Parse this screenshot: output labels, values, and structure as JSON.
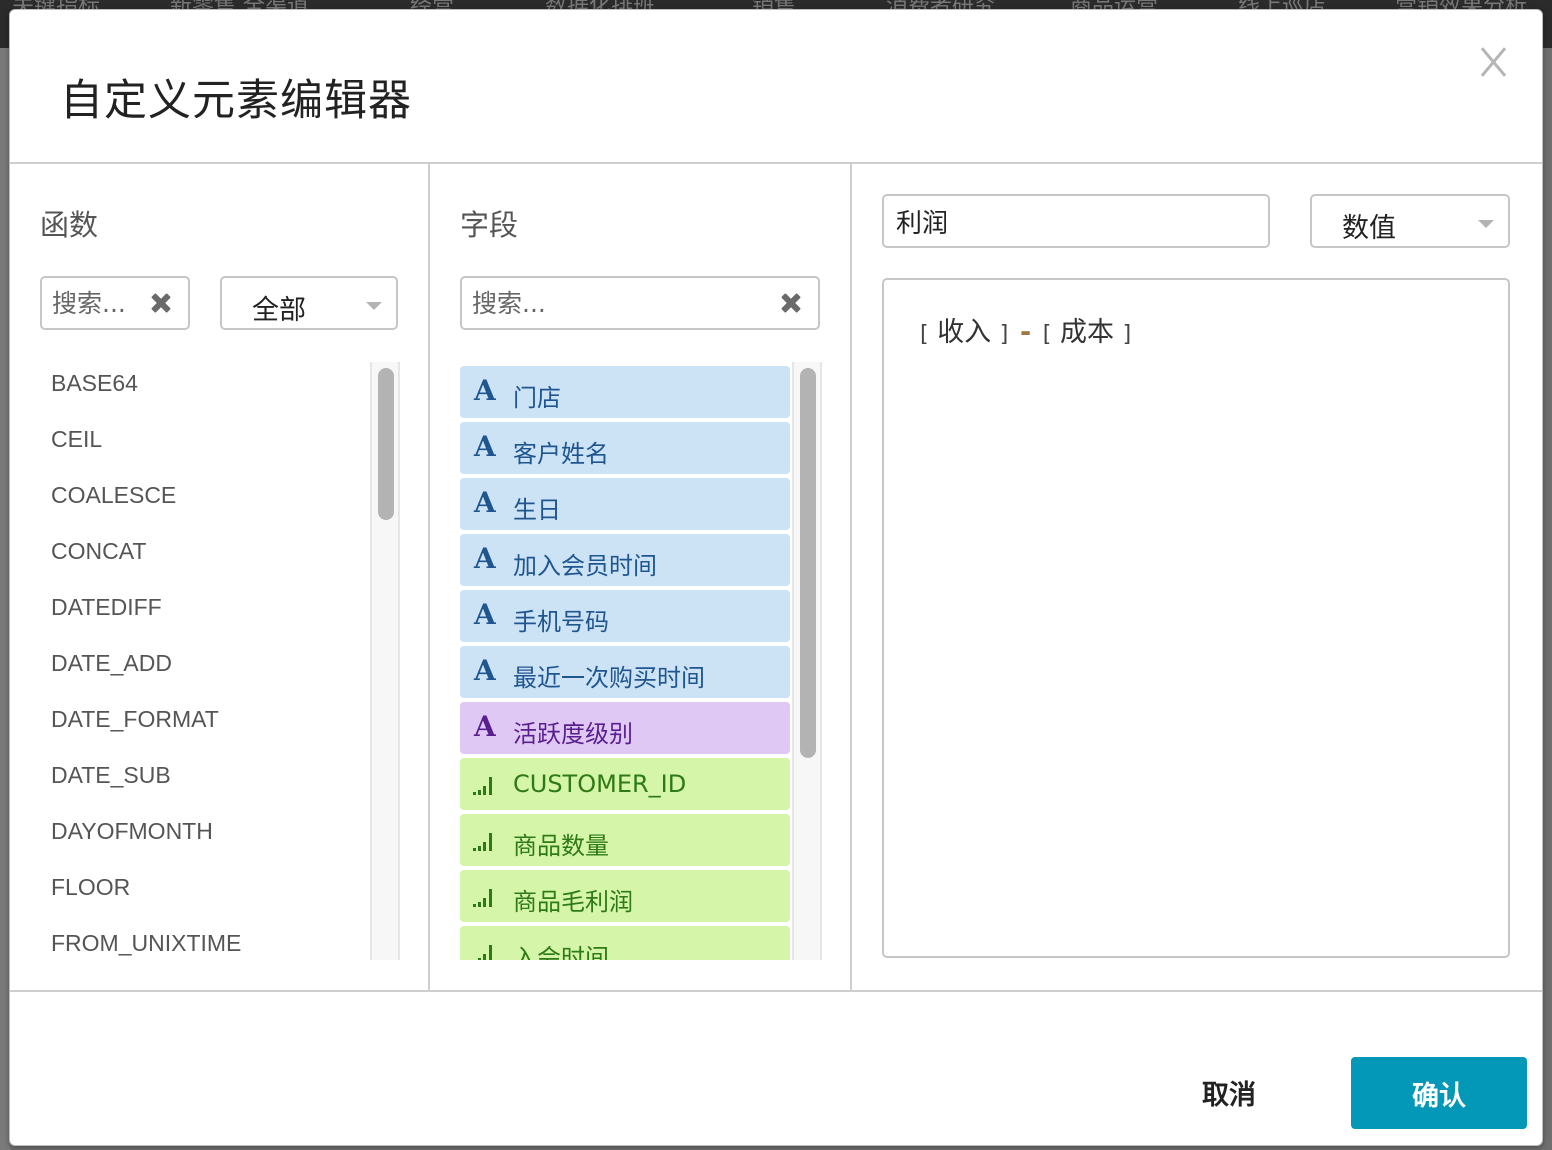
{
  "background_nav": {
    "items": [
      "关键指标",
      "新零售 全渠道",
      "经营",
      "数据化排班",
      "销售",
      "消费者研究",
      "商品运营",
      "线上巡店",
      "营销效果分析"
    ]
  },
  "modal": {
    "title": "自定义元素编辑器",
    "close_icon": "close-icon"
  },
  "functions": {
    "label": "函数",
    "search": {
      "placeholder": "搜索...",
      "value": ""
    },
    "category": {
      "selected": "全部"
    },
    "items": [
      "BASE64",
      "CEIL",
      "COALESCE",
      "CONCAT",
      "DATEDIFF",
      "DATE_ADD",
      "DATE_FORMAT",
      "DATE_SUB",
      "DAYOFMONTH",
      "FLOOR",
      "FROM_UNIXTIME"
    ]
  },
  "fields": {
    "label": "字段",
    "search": {
      "placeholder": "搜索...",
      "value": ""
    },
    "items": [
      {
        "label": "门店",
        "type": "dimension",
        "icon": "A"
      },
      {
        "label": "客户姓名",
        "type": "dimension",
        "icon": "A"
      },
      {
        "label": "生日",
        "type": "dimension",
        "icon": "A"
      },
      {
        "label": "加入会员时间",
        "type": "dimension",
        "icon": "A"
      },
      {
        "label": "手机号码",
        "type": "dimension",
        "icon": "A"
      },
      {
        "label": "最近一次购买时间",
        "type": "dimension",
        "icon": "A"
      },
      {
        "label": "活跃度级别",
        "type": "custom-dimension",
        "icon": "A"
      },
      {
        "label": "CUSTOMER_ID",
        "type": "measure",
        "icon": "bars-icon"
      },
      {
        "label": "商品数量",
        "type": "measure",
        "icon": "bars-icon"
      },
      {
        "label": "商品毛利润",
        "type": "measure",
        "icon": "bars-icon"
      },
      {
        "label": "入会时间",
        "type": "measure",
        "icon": "bars-icon"
      }
    ]
  },
  "expression": {
    "name_value": "利润",
    "data_type": {
      "selected": "数值"
    },
    "tokens": {
      "open1": "[",
      "field1": "收入",
      "close1": "]",
      "operator": "-",
      "open2": "[",
      "field2": "成本",
      "close2": "]"
    }
  },
  "footer": {
    "cancel_label": "取消",
    "confirm_label": "确认"
  },
  "colors": {
    "accent": "#0398b7",
    "dimension_bg": "#cce2f5",
    "dimension_fg": "#1f5690",
    "custom_dimension_bg": "#e0c8f5",
    "custom_dimension_fg": "#5a1f8f",
    "measure_bg": "#d5f5a8",
    "measure_fg": "#2e7a16",
    "operator": "#a0773f"
  }
}
